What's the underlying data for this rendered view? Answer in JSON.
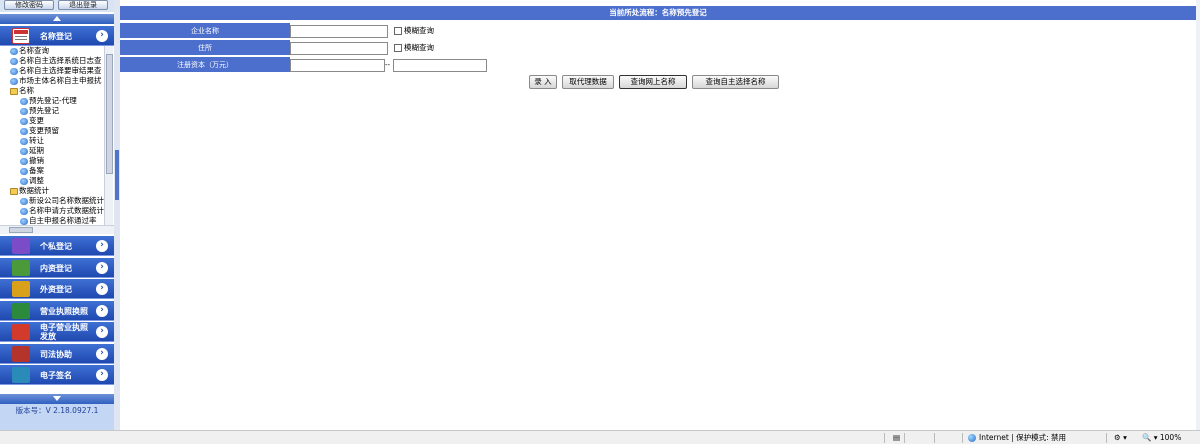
{
  "sidebar": {
    "top_buttons": [
      "修改密码",
      "退出登录"
    ],
    "sections_top": {
      "label": "名称登记",
      "icon": "name-registration-icon"
    },
    "tree": [
      {
        "label": "名称查询",
        "type": "doc",
        "indent": 1
      },
      {
        "label": "名称自主选择系统日志查",
        "type": "doc",
        "indent": 1
      },
      {
        "label": "名称自主选择要审结果查",
        "type": "doc",
        "indent": 1
      },
      {
        "label": "市场主体名称自主申报扰",
        "type": "doc",
        "indent": 1
      },
      {
        "label": "名称",
        "type": "folder",
        "indent": 1
      },
      {
        "label": "预先登记-代理",
        "type": "doc",
        "indent": 2
      },
      {
        "label": "预先登记",
        "type": "doc",
        "indent": 2
      },
      {
        "label": "变更",
        "type": "doc",
        "indent": 2
      },
      {
        "label": "变更预留",
        "type": "doc",
        "indent": 2
      },
      {
        "label": "转让",
        "type": "doc",
        "indent": 2
      },
      {
        "label": "延期",
        "type": "doc",
        "indent": 2
      },
      {
        "label": "撤销",
        "type": "doc",
        "indent": 2
      },
      {
        "label": "备案",
        "type": "doc",
        "indent": 2
      },
      {
        "label": "调整",
        "type": "doc",
        "indent": 2
      },
      {
        "label": "数据统计",
        "type": "folder",
        "indent": 1
      },
      {
        "label": "新设公司名称数据统计",
        "type": "doc",
        "indent": 2
      },
      {
        "label": "名称申请方式数据统计",
        "type": "doc",
        "indent": 2
      },
      {
        "label": "自主申报名称通过率",
        "type": "doc",
        "indent": 2
      }
    ],
    "sections": [
      {
        "label": "个私登记",
        "icon": "private-business-icon"
      },
      {
        "label": "内资登记",
        "icon": "domestic-registration-icon"
      },
      {
        "label": "外资登记",
        "icon": "foreign-registration-icon"
      },
      {
        "label": "营业执照换照",
        "icon": "license-exchange-icon"
      },
      {
        "label": "电子营业执照发放",
        "icon": "e-license-icon"
      },
      {
        "label": "司法协助",
        "icon": "judicial-assist-icon"
      },
      {
        "label": "电子签名",
        "icon": "e-signature-icon"
      }
    ],
    "version": "版本号：V 2.18.0927.1"
  },
  "main": {
    "title": "当前所处流程：名称预先登记",
    "form": {
      "company_name_label": "企业名称",
      "address_label": "住所",
      "capital_label": "注册资本（万元）",
      "fuzzy_label": "模糊查询",
      "range_sep": "--"
    },
    "buttons": [
      "录 入",
      "取代理数据",
      "查询网上名称",
      "查询自主选择名称"
    ]
  },
  "statusbar": {
    "zone": "Internet | 保护模式: 禁用",
    "zoom": "100%"
  },
  "colors": {
    "header_blue": "#4c6fcd",
    "section_blue": "#1f49b0"
  }
}
